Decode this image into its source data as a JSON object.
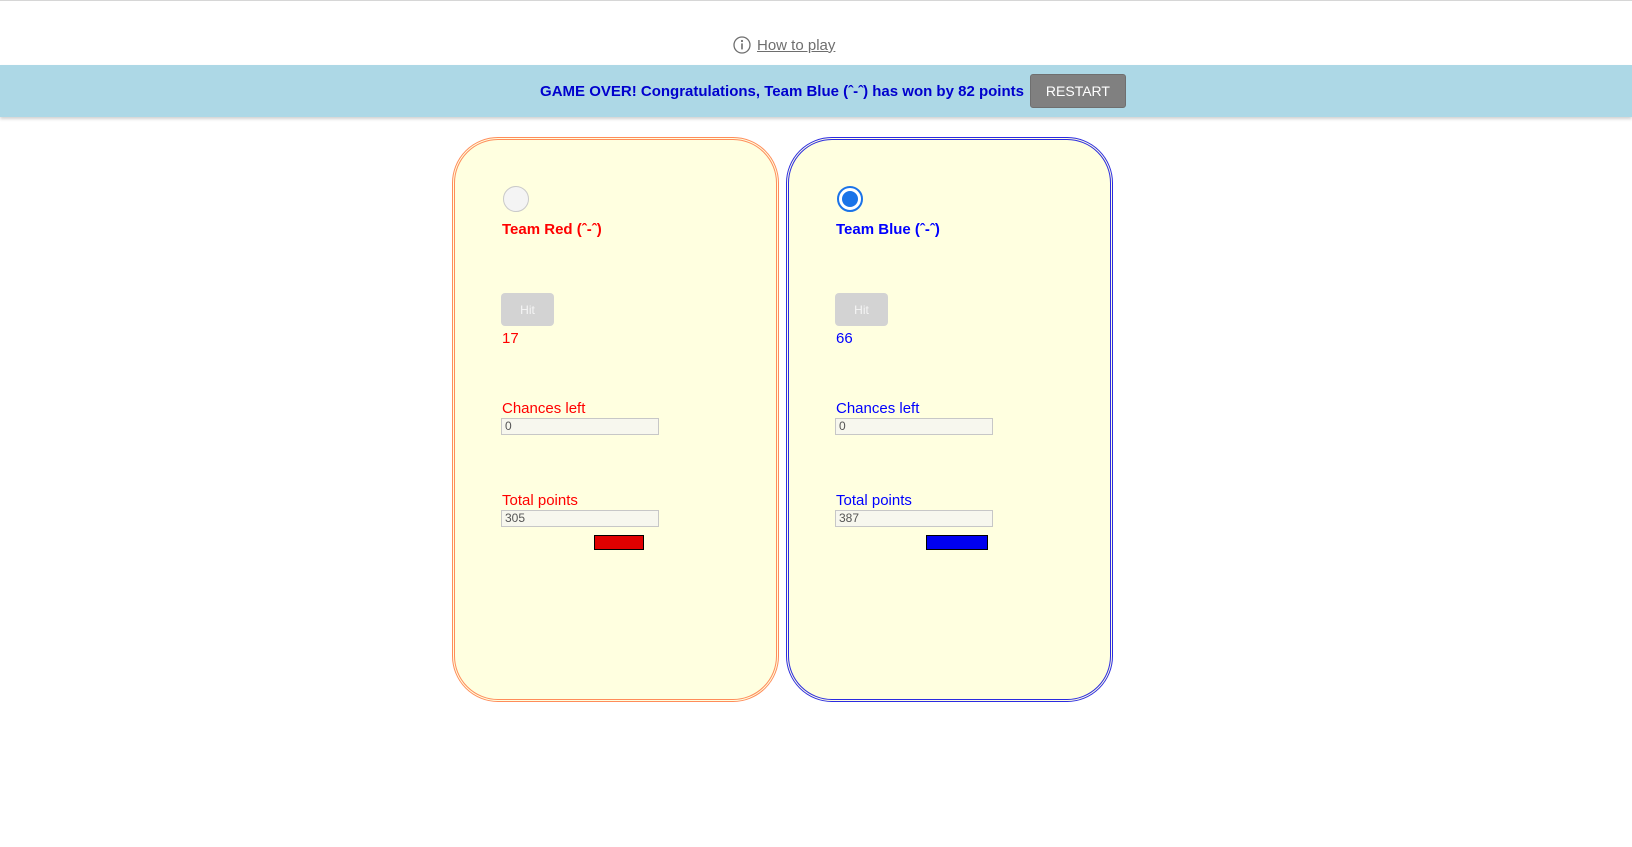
{
  "help": {
    "icon": "info-icon",
    "label": "How to play"
  },
  "banner": {
    "message": "GAME OVER! Congratulations, Team Blue (ˆ-ˆ) has won by 82 points",
    "restart_label": "RESTART",
    "background": "#add8e6",
    "text_color": "#0000cd"
  },
  "teams": [
    {
      "name": "Team Red (ˆ-ˆ)",
      "color": "#ff0000",
      "selected": false,
      "hit_label": "Hit",
      "last_hit": "17",
      "chances_label": "Chances left",
      "chances_value": "0",
      "total_label": "Total points",
      "total_value": "305"
    },
    {
      "name": "Team Blue (ˆ-ˆ)",
      "color": "#0000ff",
      "selected": true,
      "hit_label": "Hit",
      "last_hit": "66",
      "chances_label": "Chances left",
      "chances_value": "0",
      "total_label": "Total points",
      "total_value": "387"
    }
  ]
}
